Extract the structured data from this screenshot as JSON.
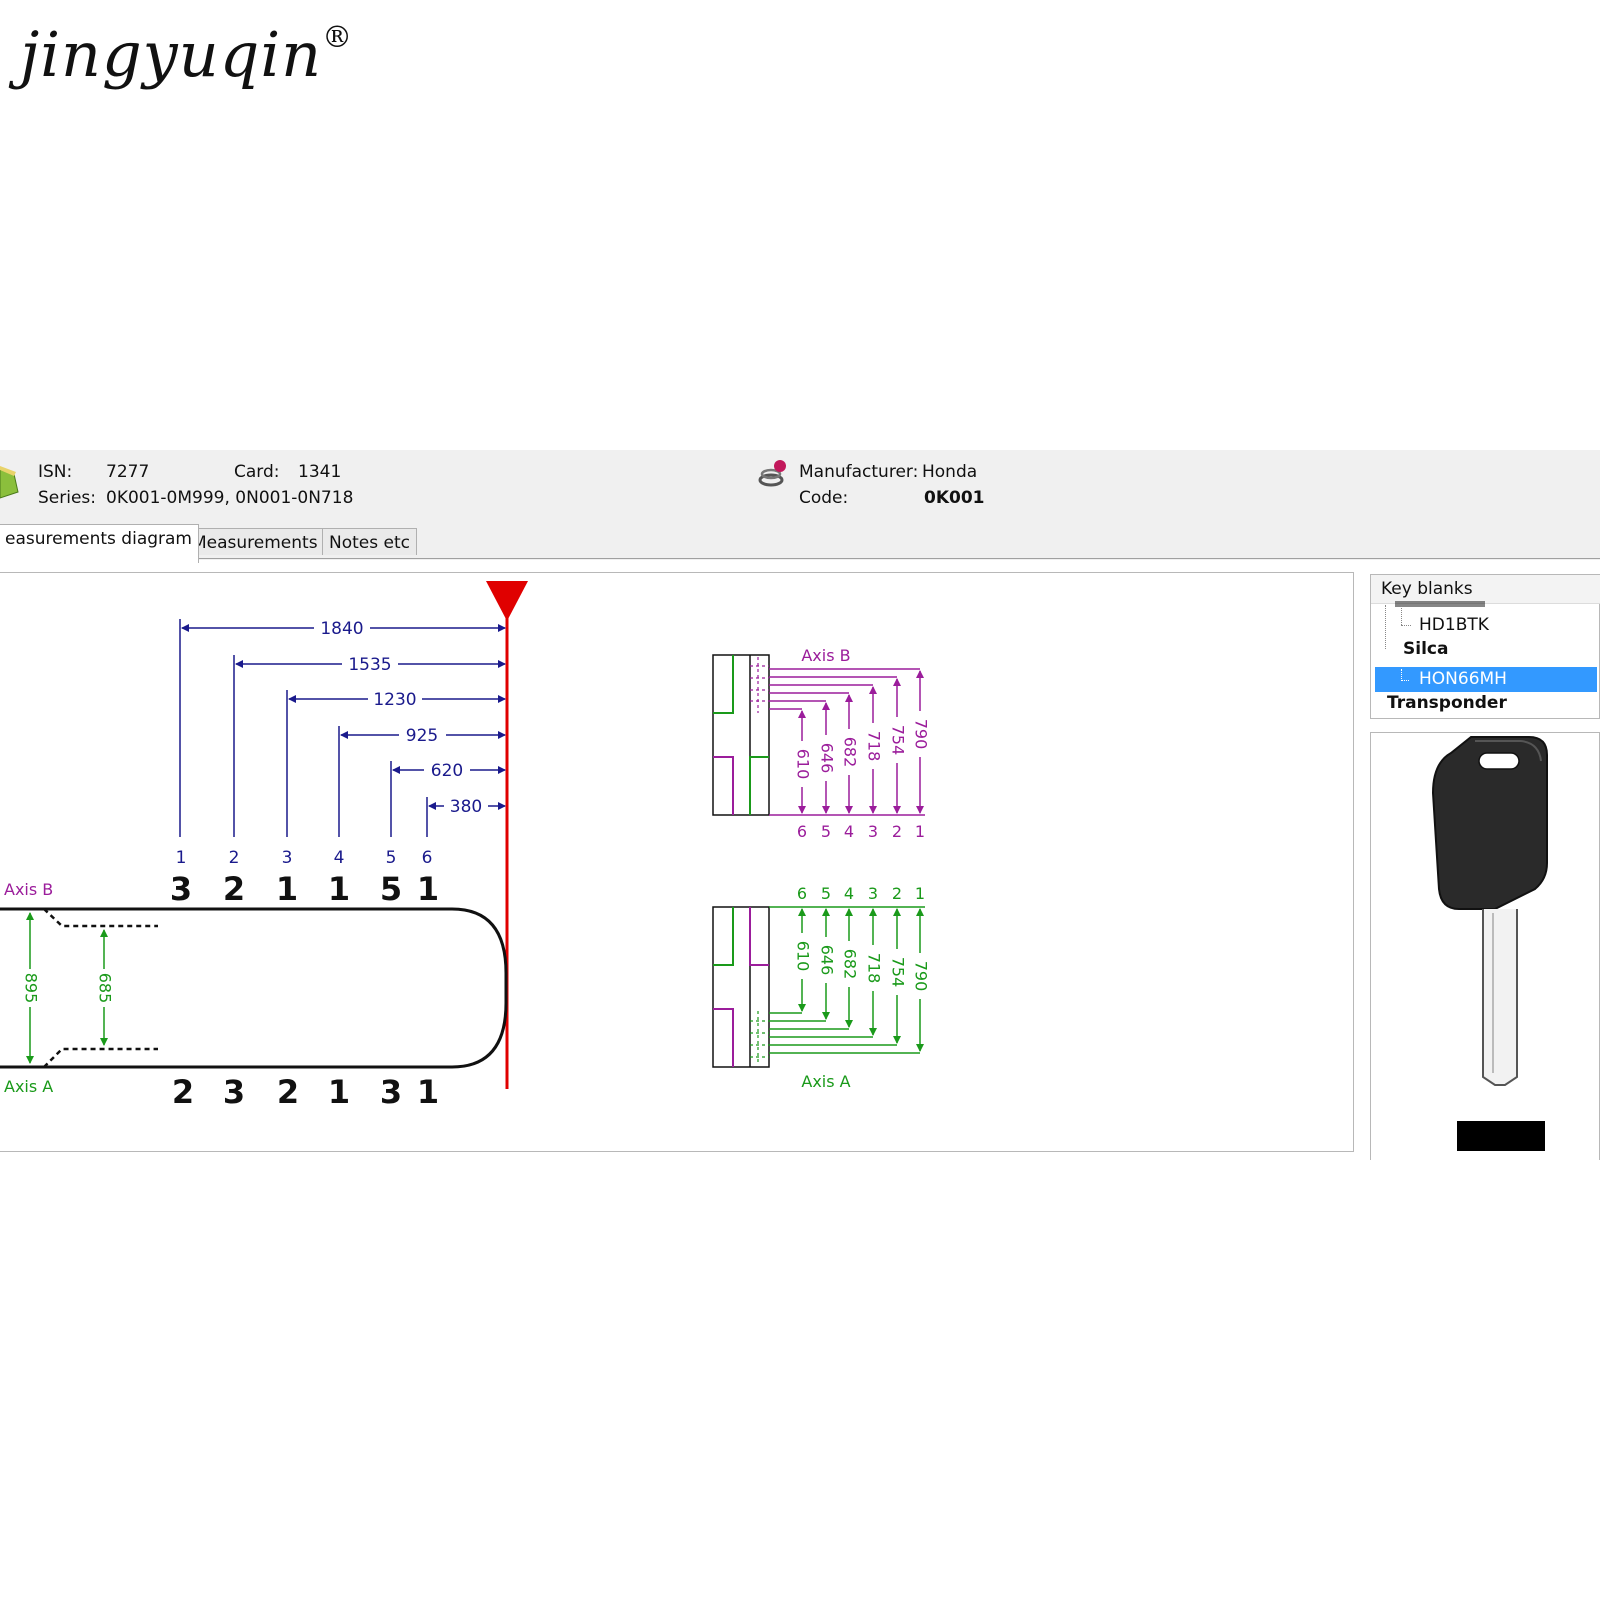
{
  "logo": {
    "text": "jingyuqin",
    "mark": "®"
  },
  "header": {
    "isn_label": "ISN:",
    "isn_value": "7277",
    "card_label": "Card:",
    "card_value": "1341",
    "series_label": "Series:",
    "series_value": "0K001-0M999, 0N001-0N718",
    "manufacturer_label": "Manufacturer:",
    "manufacturer_value": "Honda",
    "code_label": "Code:",
    "code_value": "0K001",
    "book_icon": "book-icon",
    "manufacturer_icon": "manufacturer-icon"
  },
  "tabs": [
    {
      "label": "easurements diagram",
      "active": true
    },
    {
      "label": "Measurements",
      "active": false
    },
    {
      "label": "Notes etc",
      "active": false
    }
  ],
  "diagram": {
    "spacings": [
      {
        "position": "1",
        "value": "1840"
      },
      {
        "position": "2",
        "value": "1535"
      },
      {
        "position": "3",
        "value": "1230"
      },
      {
        "position": "4",
        "value": "925"
      },
      {
        "position": "5",
        "value": "620"
      },
      {
        "position": "6",
        "value": "380"
      }
    ],
    "axis_b_label": "Axis B",
    "axis_a_label": "Axis A",
    "axis_b_cuts": [
      "3",
      "2",
      "1",
      "1",
      "5",
      "1"
    ],
    "axis_a_cuts": [
      "2",
      "3",
      "2",
      "1",
      "3",
      "1"
    ],
    "width_outer": "895",
    "width_inner": "685",
    "depth_values": [
      "610",
      "646",
      "682",
      "718",
      "754",
      "790"
    ],
    "depth_numbers": [
      "6",
      "5",
      "4",
      "3",
      "2",
      "1"
    ],
    "colors": {
      "axis_b": "#9b1d9b",
      "axis_a": "#1a9a1a",
      "spacing": "#1a1a8c",
      "stop": "#e00000"
    }
  },
  "key_blanks": {
    "header": "Key blanks",
    "items": [
      {
        "label": "HD1BTK",
        "level": 2,
        "bold": false,
        "selected": false
      },
      {
        "label": "Silca",
        "level": 1,
        "bold": true,
        "selected": false
      },
      {
        "label": "HON66MH",
        "level": 2,
        "bold": false,
        "selected": true
      },
      {
        "label": "Transponder",
        "level": 0,
        "bold": true,
        "selected": false
      }
    ]
  }
}
